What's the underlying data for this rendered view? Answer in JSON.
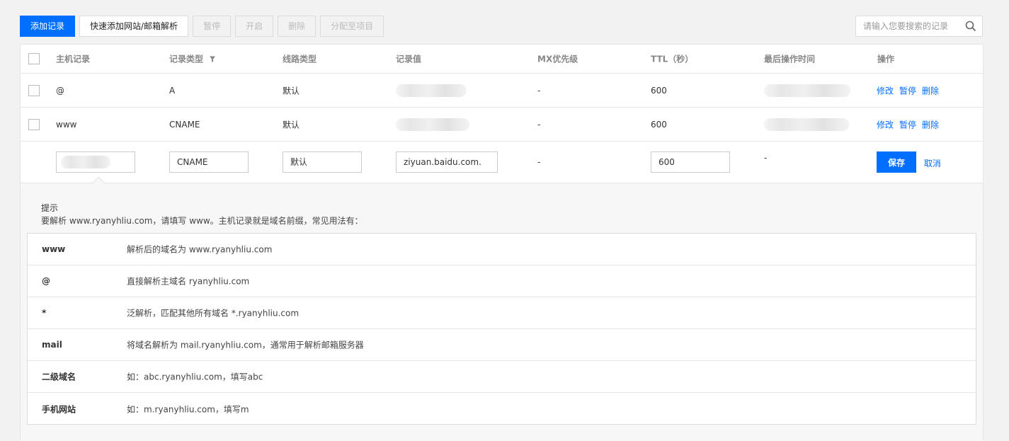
{
  "toolbar": {
    "add_record": "添加记录",
    "quick_add": "快速添加网站/邮箱解析",
    "pause": "暂停",
    "enable": "开启",
    "delete": "删除",
    "assign_project": "分配至项目"
  },
  "search": {
    "placeholder": "请输入您要搜索的记录"
  },
  "table": {
    "columns": {
      "host": "主机记录",
      "type": "记录类型",
      "line": "线路类型",
      "value": "记录值",
      "mx": "MX优先级",
      "ttl": "TTL（秒）",
      "updated": "最后操作时间",
      "ops": "操作"
    },
    "rows": [
      {
        "host": "@",
        "type": "A",
        "line": "默认",
        "mx": "-",
        "ttl": "600",
        "edit": "修改",
        "pause": "暂停",
        "delete": "删除"
      },
      {
        "host": "www",
        "type": "CNAME",
        "line": "默认",
        "mx": "-",
        "ttl": "600",
        "edit": "修改",
        "pause": "暂停",
        "delete": "删除"
      }
    ],
    "edit_row": {
      "type": "CNAME",
      "line": "默认",
      "value": "ziyuan.baidu.com.",
      "mx": "-",
      "ttl": "600",
      "updated": "-",
      "save": "保存",
      "cancel": "取消"
    }
  },
  "tip": {
    "title": "提示",
    "desc": "要解析 www.ryanyhliu.com，请填写 www。主机记录就是域名前缀，常见用法有：",
    "items": [
      {
        "key": "www",
        "value": "解析后的域名为 www.ryanyhliu.com"
      },
      {
        "key": "@",
        "value": "直接解析主域名 ryanyhliu.com"
      },
      {
        "key": "*",
        "value": "泛解析，匹配其他所有域名 *.ryanyhliu.com"
      },
      {
        "key": "mail",
        "value": "将域名解析为 mail.ryanyhliu.com，通常用于解析邮箱服务器"
      },
      {
        "key": "二级域名",
        "value": "如：abc.ryanyhliu.com，填写abc"
      },
      {
        "key": "手机网站",
        "value": "如：m.ryanyhliu.com，填写m"
      }
    ]
  }
}
